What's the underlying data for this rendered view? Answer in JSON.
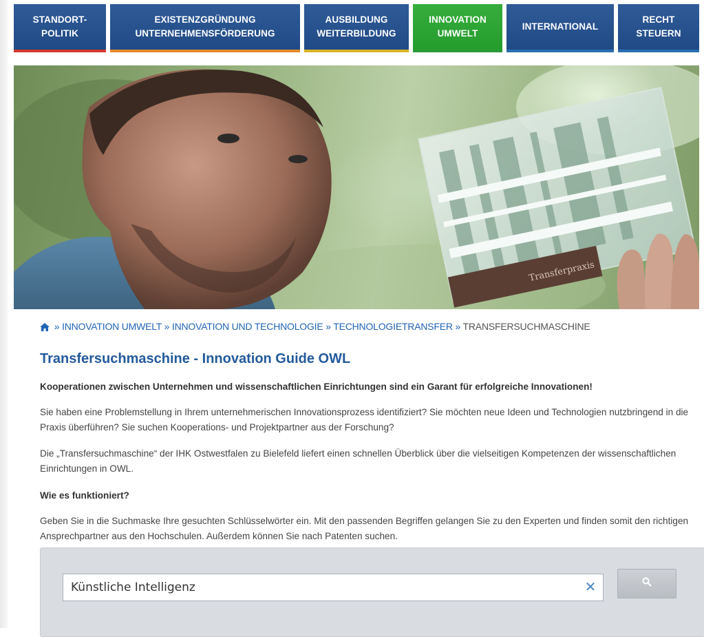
{
  "nav": {
    "tabs": [
      {
        "line1": "STANDORT-",
        "line2": "POLITIK",
        "bar_color": "#d33a2f"
      },
      {
        "line1": "EXISTENZGRÜNDUNG",
        "line2": "UNTERNEHMENSFÖRDERUNG",
        "bar_color": "#e58a2b"
      },
      {
        "line1": "AUSBILDUNG",
        "line2": "WEITERBILDUNG",
        "bar_color": "#d9b425"
      },
      {
        "line1": "INNOVATION",
        "line2": "UMWELT",
        "bar_color": "#2a9a36"
      },
      {
        "line1": "INTERNATIONAL",
        "line2": "",
        "bar_color": "#2c6fb3"
      },
      {
        "line1": "RECHT",
        "line2": "STEUERN",
        "bar_color": "#2c6fb3"
      }
    ]
  },
  "breadcrumb": {
    "items": [
      "INNOVATION UMWELT",
      "INNOVATION UND TECHNOLOGIE",
      "TECHNOLOGIETRANSFER",
      "TRANSFERSUCHMASCHINE"
    ],
    "separator": "»"
  },
  "hero": {
    "plate_label": "Transferpraxis"
  },
  "content": {
    "title": "Transfersuchmaschine - Innovation Guide OWL",
    "lead": "Kooperationen zwischen Unternehmen und wissenschaftlichen Einrichtungen sind ein Garant für erfolgreiche Innovationen!",
    "para1": "Sie haben eine Problemstellung in Ihrem unternehmerischen Innovationsprozess identifiziert? Sie möchten neue Ideen und Technologien nutzbringend  in die Praxis überführen? Sie suchen Kooperations- und Projektpartner aus der Forschung?",
    "para2": "Die „Transfersuchmaschine“ der IHK Ostwestfalen zu Bielefeld liefert einen schnellen Überblick über die vielseitigen Kompetenzen der wissenschaftlichen Einrichtungen in OWL.",
    "subheading": "Wie es funktioniert?",
    "para3": "Geben Sie in die Suchmaske Ihre gesuchten Schlüsselwörter ein. Mit den passenden Begriffen gelangen Sie zu den Experten und finden somit den richtigen Ansprechpartner aus den Hochschulen. Außerdem können Sie nach Patenten suchen."
  },
  "search": {
    "value": "Künstliche Intelligenz",
    "clear_icon": "close-icon",
    "button_icon": "search-icon"
  },
  "colors": {
    "nav_blue": "#214b87",
    "nav_active_green": "#2ea336",
    "link_blue": "#2264b5",
    "title_blue": "#235a9b"
  }
}
